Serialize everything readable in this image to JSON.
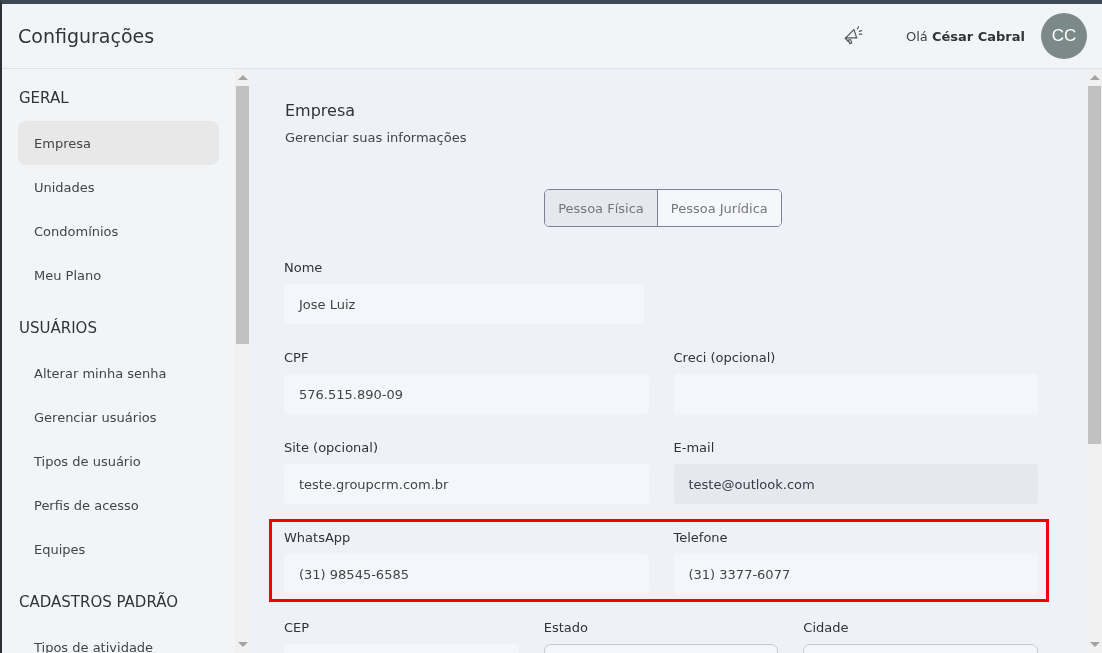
{
  "header": {
    "title": "Configurações",
    "greeting": "Olá **César Cabral**",
    "avatar_initials": "CC"
  },
  "sidebar": {
    "sections": [
      {
        "title": "GERAL",
        "items": [
          {
            "label": "Empresa",
            "selected": true
          },
          {
            "label": "Unidades",
            "selected": false
          },
          {
            "label": "Condomínios",
            "selected": false
          },
          {
            "label": "Meu Plano",
            "selected": false
          }
        ]
      },
      {
        "title": "USUÁRIOS",
        "items": [
          {
            "label": "Alterar minha senha",
            "selected": false
          },
          {
            "label": "Gerenciar usuários",
            "selected": false
          },
          {
            "label": "Tipos de usuário",
            "selected": false
          },
          {
            "label": "Perfis de acesso",
            "selected": false
          },
          {
            "label": "Equipes",
            "selected": false
          }
        ]
      },
      {
        "title": "CADASTROS PADRÃO",
        "items": [
          {
            "label": "Tipos de atividade",
            "selected": false
          }
        ]
      }
    ]
  },
  "main": {
    "title": "Empresa",
    "subtitle": "Gerenciar suas informações",
    "person_type": [
      {
        "label": "Pessoa Física",
        "selected": true
      },
      {
        "label": "Pessoa Jurídica",
        "selected": false
      }
    ],
    "rows": [
      {
        "highlighted": false,
        "fields": [
          {
            "label": "Nome",
            "value": "Jose Luiz",
            "kind": "text",
            "disabled": false
          }
        ]
      },
      {
        "highlighted": false,
        "fields": [
          {
            "label": "CPF",
            "value": "576.515.890-09",
            "kind": "text",
            "disabled": false
          },
          {
            "label": "Creci (opcional)",
            "kind": "text",
            "disabled": false
          }
        ]
      },
      {
        "highlighted": false,
        "fields": [
          {
            "label": "Site (opcional)",
            "value": "teste.groupcrm.com.br",
            "kind": "text",
            "disabled": false
          },
          {
            "label": "E-mail",
            "value": "teste@outlook.com",
            "kind": "text",
            "disabled": true
          }
        ]
      },
      {
        "highlighted": true,
        "fields": [
          {
            "label": "WhatsApp",
            "value": "(31) 98545-6585",
            "kind": "text",
            "disabled": false
          },
          {
            "label": "Telefone",
            "value": "(31) 3377-6077",
            "kind": "text",
            "disabled": false
          }
        ]
      },
      {
        "highlighted": false,
        "fields": [
          {
            "label": "CEP",
            "kind": "text"
          },
          {
            "label": "Estado",
            "kind": "select"
          },
          {
            "label": "Cidade",
            "kind": "select"
          }
        ]
      }
    ]
  }
}
